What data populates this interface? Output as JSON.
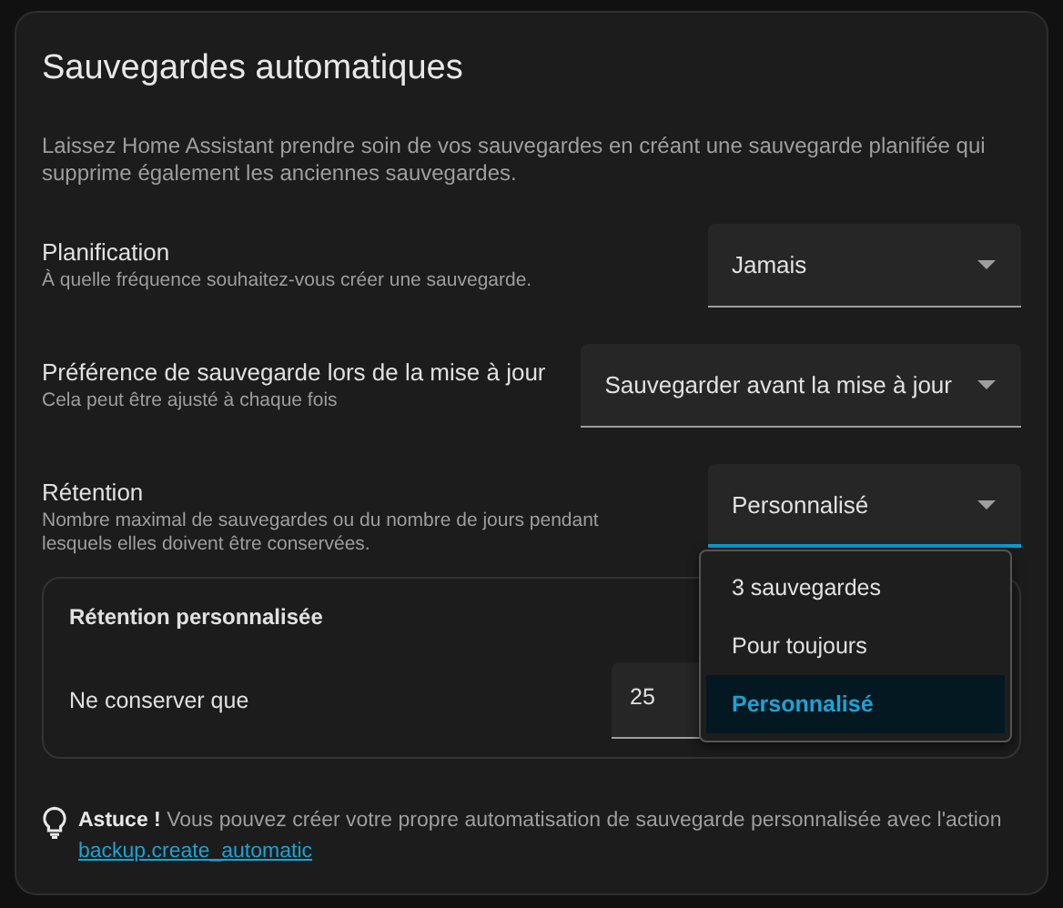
{
  "title": "Sauvegardes automatiques",
  "description": "Laissez Home Assistant prendre soin de vos sauvegardes en créant une sauvegarde planifiée qui supprime également les anciennes sauvegardes.",
  "settings": [
    {
      "label": "Planification",
      "hint": "À quelle fréquence souhaitez-vous créer une sauvegarde.",
      "value": "Jamais",
      "focused": false
    },
    {
      "label": "Préférence de sauvegarde lors de la mise à jour",
      "hint": "Cela peut être ajusté à chaque fois",
      "value": "Sauvegarder avant la mise à jour",
      "focused": false
    },
    {
      "label": "Rétention",
      "hint": "Nombre maximal de sauvegardes ou du nombre de jours pendant lesquels elles doivent être conservées.",
      "value": "Personnalisé",
      "focused": true
    }
  ],
  "menu_options": [
    {
      "label": "3 sauvegardes",
      "selected": false
    },
    {
      "label": "Pour toujours",
      "selected": false
    },
    {
      "label": "Personnalisé",
      "selected": true
    }
  ],
  "custom_retention": {
    "title": "Rétention personnalisée",
    "label": "Ne conserver que",
    "value": "25"
  },
  "tip": {
    "text": "**Astuce !** Vous pouvez créer votre propre automatisation de sauvegarde personnalisée avec l'action",
    "link": "backup.create_automatic"
  }
}
